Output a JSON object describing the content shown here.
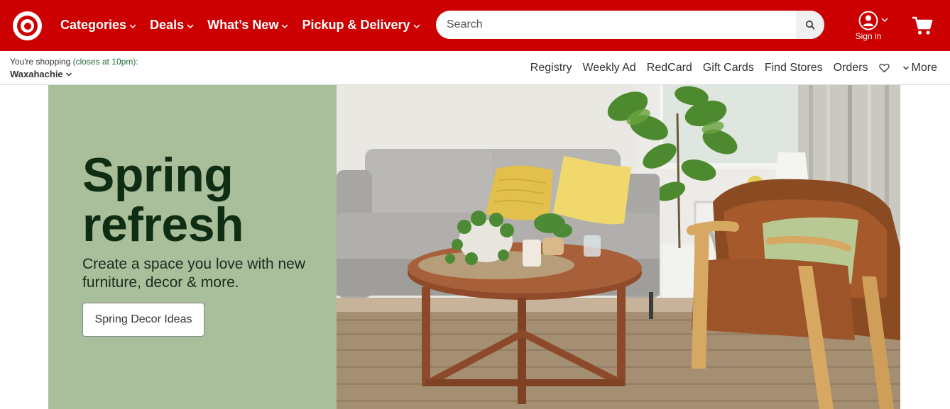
{
  "brand": {
    "logo": "target-logo-icon",
    "color": "#cc0000"
  },
  "nav": {
    "items": [
      {
        "label": "Categories"
      },
      {
        "label": "Deals"
      },
      {
        "label": "What’s New"
      },
      {
        "label": "Pickup & Delivery"
      }
    ]
  },
  "search": {
    "placeholder": "Search",
    "icon": "search-icon"
  },
  "account": {
    "label": "Sign in",
    "icon": "user-icon"
  },
  "cart": {
    "icon": "cart-icon"
  },
  "store": {
    "prefix": "You're shopping",
    "hours": "(closes at 10pm):",
    "name": "Waxahachie"
  },
  "utility": {
    "links": [
      "Registry",
      "Weekly Ad",
      "RedCard",
      "Gift Cards",
      "Find Stores",
      "Orders"
    ],
    "favorites_icon": "heart-icon",
    "more_label": "More"
  },
  "hero": {
    "title_line1": "Spring",
    "title_line2": "refresh",
    "subtitle": "Create a space you love with new furniture, decor & more.",
    "cta_label": "Spring Decor Ideas",
    "bg_color": "#a9bf9b",
    "title_color": "#0f2d12"
  }
}
